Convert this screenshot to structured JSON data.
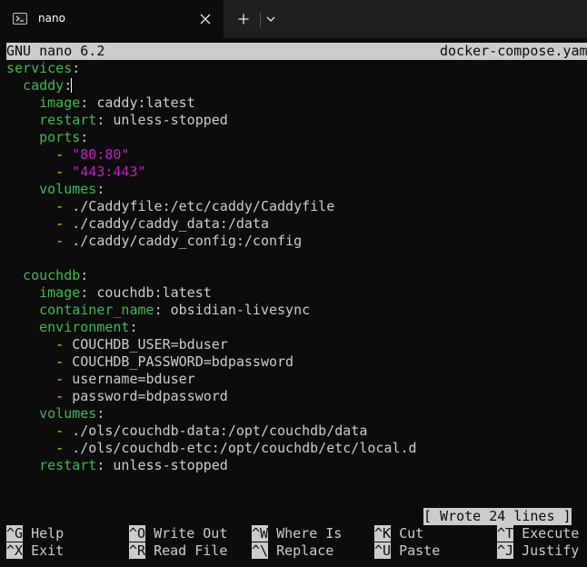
{
  "window": {
    "tab_title": "nano",
    "tab_icon": "terminal-icon",
    "close_icon": "close-icon",
    "new_tab_icon": "plus-icon",
    "dropdown_icon": "chevron-down-icon"
  },
  "nano": {
    "version": "GNU nano 6.2",
    "filename": "docker-compose.yam",
    "status_message": "[ Wrote 24 lines ]"
  },
  "colors": {
    "key": "#3fb950",
    "string": "#c41dc4",
    "dash": "#e8d400",
    "text": "#cccccc",
    "background": "#0c0c0c",
    "bar": "#cccccc"
  },
  "editor_lines": [
    [
      {
        "t": "services",
        "c": "k"
      },
      {
        "t": ":",
        "c": "p"
      }
    ],
    [
      {
        "t": "  caddy",
        "c": "k"
      },
      {
        "t": ":",
        "c": "p"
      },
      {
        "cursor": true
      }
    ],
    [
      {
        "t": "    image",
        "c": "k"
      },
      {
        "t": ": caddy:latest",
        "c": "v"
      }
    ],
    [
      {
        "t": "    restart",
        "c": "k"
      },
      {
        "t": ": unless-stopped",
        "c": "v"
      }
    ],
    [
      {
        "t": "    ports",
        "c": "k"
      },
      {
        "t": ":",
        "c": "p"
      }
    ],
    [
      {
        "t": "      -",
        "c": "d"
      },
      {
        "t": " ",
        "c": "v"
      },
      {
        "t": "\"80:80\"",
        "c": "s"
      }
    ],
    [
      {
        "t": "      -",
        "c": "d"
      },
      {
        "t": " ",
        "c": "v"
      },
      {
        "t": "\"443:443\"",
        "c": "s"
      }
    ],
    [
      {
        "t": "    volumes",
        "c": "k"
      },
      {
        "t": ":",
        "c": "p"
      }
    ],
    [
      {
        "t": "      -",
        "c": "d"
      },
      {
        "t": " ./Caddyfile:/etc/caddy/Caddyfile",
        "c": "v"
      }
    ],
    [
      {
        "t": "      -",
        "c": "d"
      },
      {
        "t": " ./caddy/caddy_data:/data",
        "c": "v"
      }
    ],
    [
      {
        "t": "      -",
        "c": "d"
      },
      {
        "t": " ./caddy/caddy_config:/config",
        "c": "v"
      }
    ],
    [],
    [
      {
        "t": "  couchdb",
        "c": "k"
      },
      {
        "t": ":",
        "c": "p"
      }
    ],
    [
      {
        "t": "    image",
        "c": "k"
      },
      {
        "t": ": couchdb:latest",
        "c": "v"
      }
    ],
    [
      {
        "t": "    container_name",
        "c": "k"
      },
      {
        "t": ": obsidian-livesync",
        "c": "v"
      }
    ],
    [
      {
        "t": "    environment",
        "c": "k"
      },
      {
        "t": ":",
        "c": "p"
      }
    ],
    [
      {
        "t": "      -",
        "c": "d"
      },
      {
        "t": " COUCHDB_USER=bduser",
        "c": "v"
      }
    ],
    [
      {
        "t": "      -",
        "c": "d"
      },
      {
        "t": " COUCHDB_PASSWORD=bdpassword",
        "c": "v"
      }
    ],
    [
      {
        "t": "      -",
        "c": "d"
      },
      {
        "t": " username=bduser",
        "c": "v"
      }
    ],
    [
      {
        "t": "      -",
        "c": "d"
      },
      {
        "t": " password=bdpassword",
        "c": "v"
      }
    ],
    [
      {
        "t": "    volumes",
        "c": "k"
      },
      {
        "t": ":",
        "c": "p"
      }
    ],
    [
      {
        "t": "      -",
        "c": "d"
      },
      {
        "t": " ./ols/couchdb-data:/opt/couchdb/data",
        "c": "v"
      }
    ],
    [
      {
        "t": "      -",
        "c": "d"
      },
      {
        "t": " ./ols/couchdb-etc:/opt/couchdb/etc/local.d",
        "c": "v"
      }
    ],
    [
      {
        "t": "    restart",
        "c": "k"
      },
      {
        "t": ": unless-stopped",
        "c": "v"
      }
    ]
  ],
  "shortcuts": [
    {
      "key": "^G",
      "label": "Help",
      "name": "help"
    },
    {
      "key": "^O",
      "label": "Write Out",
      "name": "write-out"
    },
    {
      "key": "^W",
      "label": "Where Is",
      "name": "where-is"
    },
    {
      "key": "^K",
      "label": "Cut",
      "name": "cut"
    },
    {
      "key": "^T",
      "label": "Execute",
      "name": "execute"
    },
    {
      "key": "^X",
      "label": "Exit",
      "name": "exit"
    },
    {
      "key": "^R",
      "label": "Read File",
      "name": "read-file"
    },
    {
      "key": "^\\",
      "label": "Replace",
      "name": "replace"
    },
    {
      "key": "^U",
      "label": "Paste",
      "name": "paste"
    },
    {
      "key": "^J",
      "label": "Justify",
      "name": "justify"
    }
  ]
}
